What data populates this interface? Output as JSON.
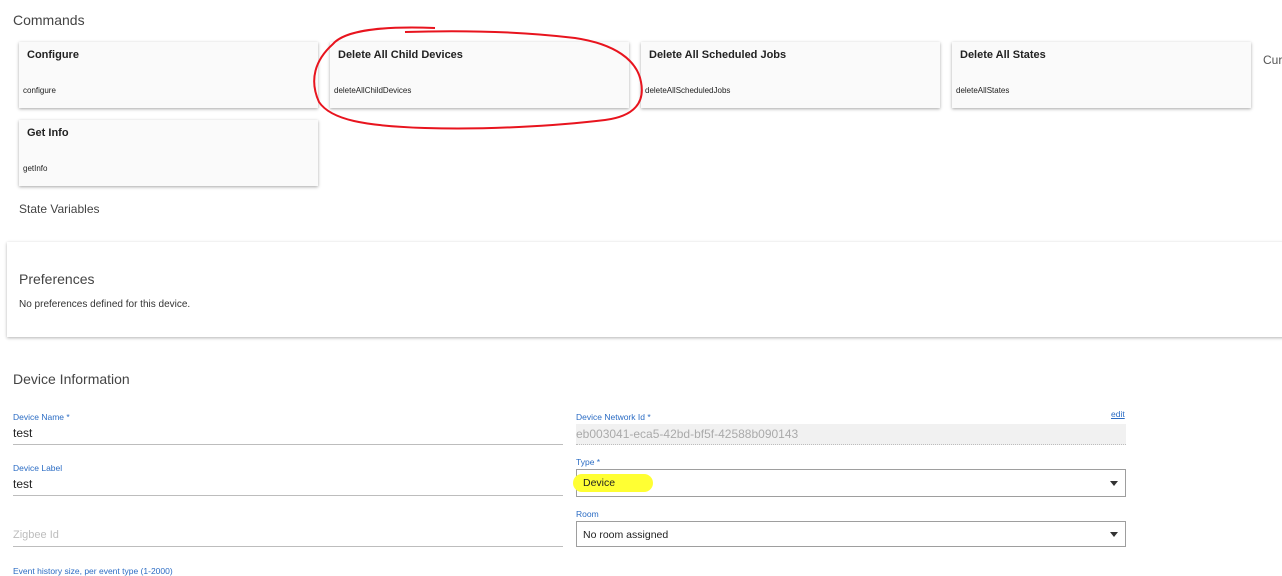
{
  "commands": {
    "title": "Commands",
    "cut_label": "Cur",
    "cards": [
      {
        "title": "Configure",
        "method": "configure"
      },
      {
        "title": "Delete All Child Devices",
        "method": "deleteAllChildDevices"
      },
      {
        "title": "Delete All Scheduled Jobs",
        "method": "deleteAllScheduledJobs"
      },
      {
        "title": "Delete All States",
        "method": "deleteAllStates"
      },
      {
        "title": "Get Info",
        "method": "getInfo"
      }
    ]
  },
  "state_variables": {
    "title": "State Variables"
  },
  "preferences": {
    "title": "Preferences",
    "message": "No preferences defined for this device."
  },
  "device_info": {
    "title": "Device Information",
    "device_name": {
      "label": "Device Name *",
      "value": "test"
    },
    "device_label": {
      "label": "Device Label",
      "value": "test"
    },
    "zigbee_id": {
      "placeholder": "Zigbee Id"
    },
    "event_history": {
      "label": "Event history size, per event type (1-2000)"
    },
    "network_id": {
      "label": "Device Network Id *",
      "value": "eb003041-eca5-42bd-bf5f-42588b090143",
      "edit_link": "edit"
    },
    "type": {
      "label": "Type *",
      "value": "Device"
    },
    "room": {
      "label": "Room",
      "value": "No room assigned"
    }
  },
  "colors": {
    "annotation_circle": "#e8141e",
    "highlight": "#ffff33",
    "label_blue": "#2b6cc4"
  }
}
